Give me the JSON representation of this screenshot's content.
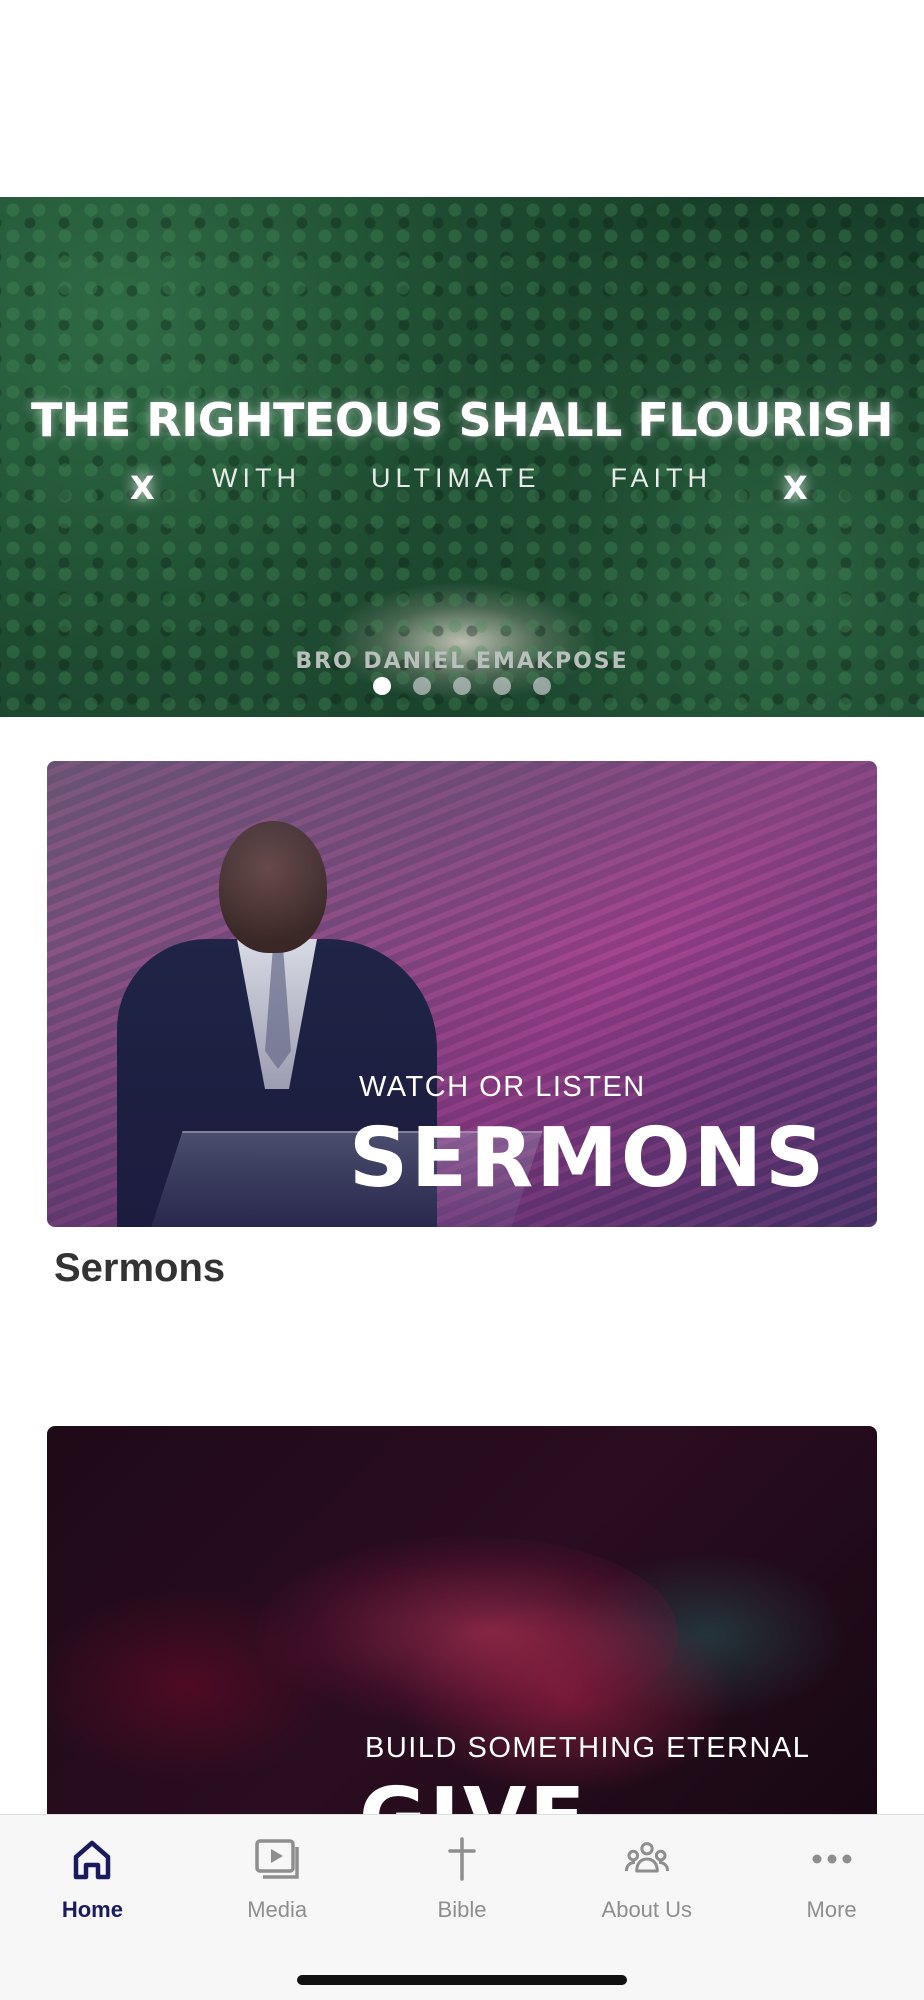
{
  "hero": {
    "title": "THE RIGHTEOUS SHALL FLOURISH",
    "subtitle_words": [
      "WITH",
      "ULTIMATE",
      "FAITH"
    ],
    "x_mark": "X",
    "speaker": "BRO DANIEL EMAKPOSE",
    "carousel": {
      "total": 5,
      "active_index": 0
    }
  },
  "cards": [
    {
      "kicker": "WATCH OR LISTEN",
      "headline": "SERMONS",
      "label": "Sermons"
    },
    {
      "kicker": "BUILD SOMETHING ETERNAL",
      "headline": "GIVE"
    }
  ],
  "tabbar": {
    "tabs": [
      {
        "label": "Home",
        "icon": "home-icon",
        "active": true
      },
      {
        "label": "Media",
        "icon": "media-icon",
        "active": false
      },
      {
        "label": "Bible",
        "icon": "cross-icon",
        "active": false
      },
      {
        "label": "About Us",
        "icon": "people-icon",
        "active": false
      },
      {
        "label": "More",
        "icon": "more-icon",
        "active": false
      }
    ]
  },
  "colors": {
    "active_tab": "#1a1a5e",
    "inactive_tab": "#8e8e8e"
  }
}
